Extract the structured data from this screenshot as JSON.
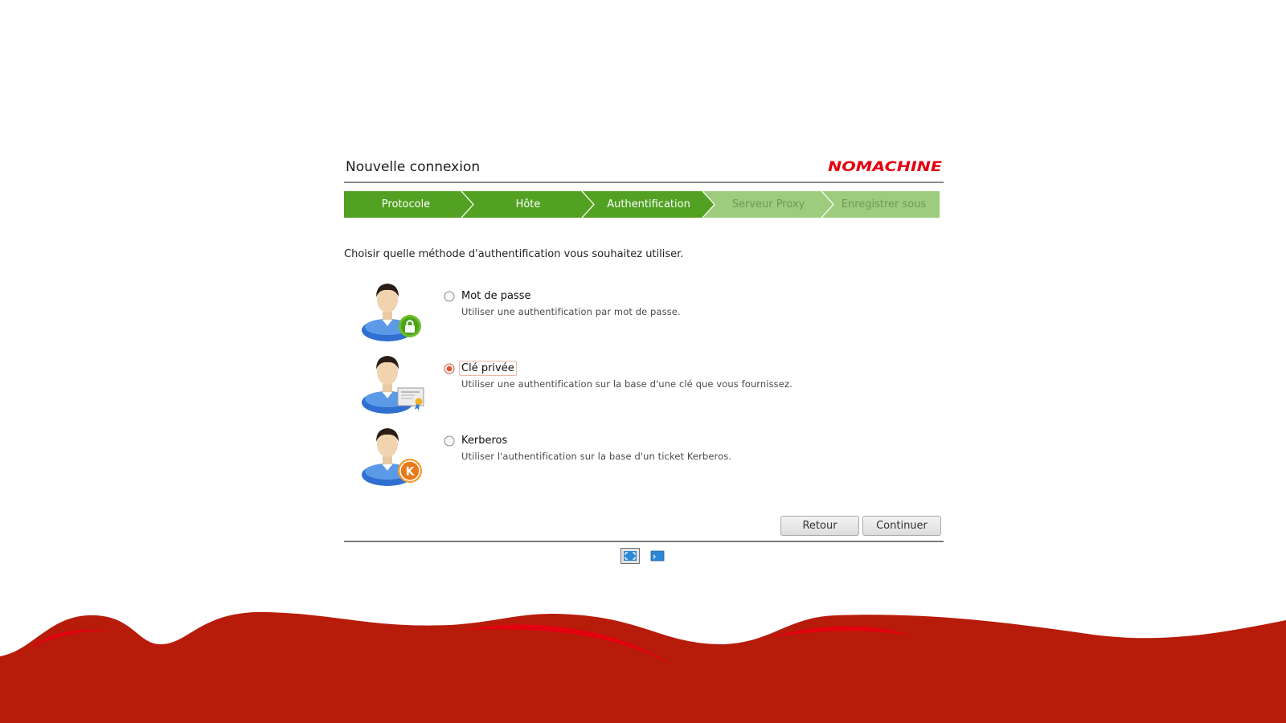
{
  "header": {
    "title": "Nouvelle connexion",
    "brand": "NOMACHINE"
  },
  "steps": [
    {
      "label": "Protocole",
      "state": "done"
    },
    {
      "label": "Hôte",
      "state": "done"
    },
    {
      "label": "Authentification",
      "state": "current"
    },
    {
      "label": "Serveur Proxy",
      "state": "pending"
    },
    {
      "label": "Enregistrer sous",
      "state": "pending"
    }
  ],
  "prompt": "Choisir quelle méthode d'authentification vous souhaitez utiliser.",
  "options": [
    {
      "label": "Mot de passe",
      "description": "Utiliser une authentification par mot de passe.",
      "selected": false,
      "badge_icon": "lock-icon"
    },
    {
      "label": "Clé privée",
      "description": "Utiliser une authentification sur la base d'une clé  que vous fournissez.",
      "selected": true,
      "badge_icon": "certificate-icon"
    },
    {
      "label": "Kerberos",
      "description": "Utiliser l'authentification sur la base d'un ticket Kerberos.",
      "selected": false,
      "badge_icon": "kerberos-icon"
    }
  ],
  "buttons": {
    "back": "Retour",
    "continue": "Continuer"
  },
  "colors": {
    "step_done": "#52a122",
    "step_pending": "#9dcc7d",
    "brand_red": "#e3000f",
    "wave_red": "#b71c0b",
    "radio_selected": "#e0552f"
  }
}
